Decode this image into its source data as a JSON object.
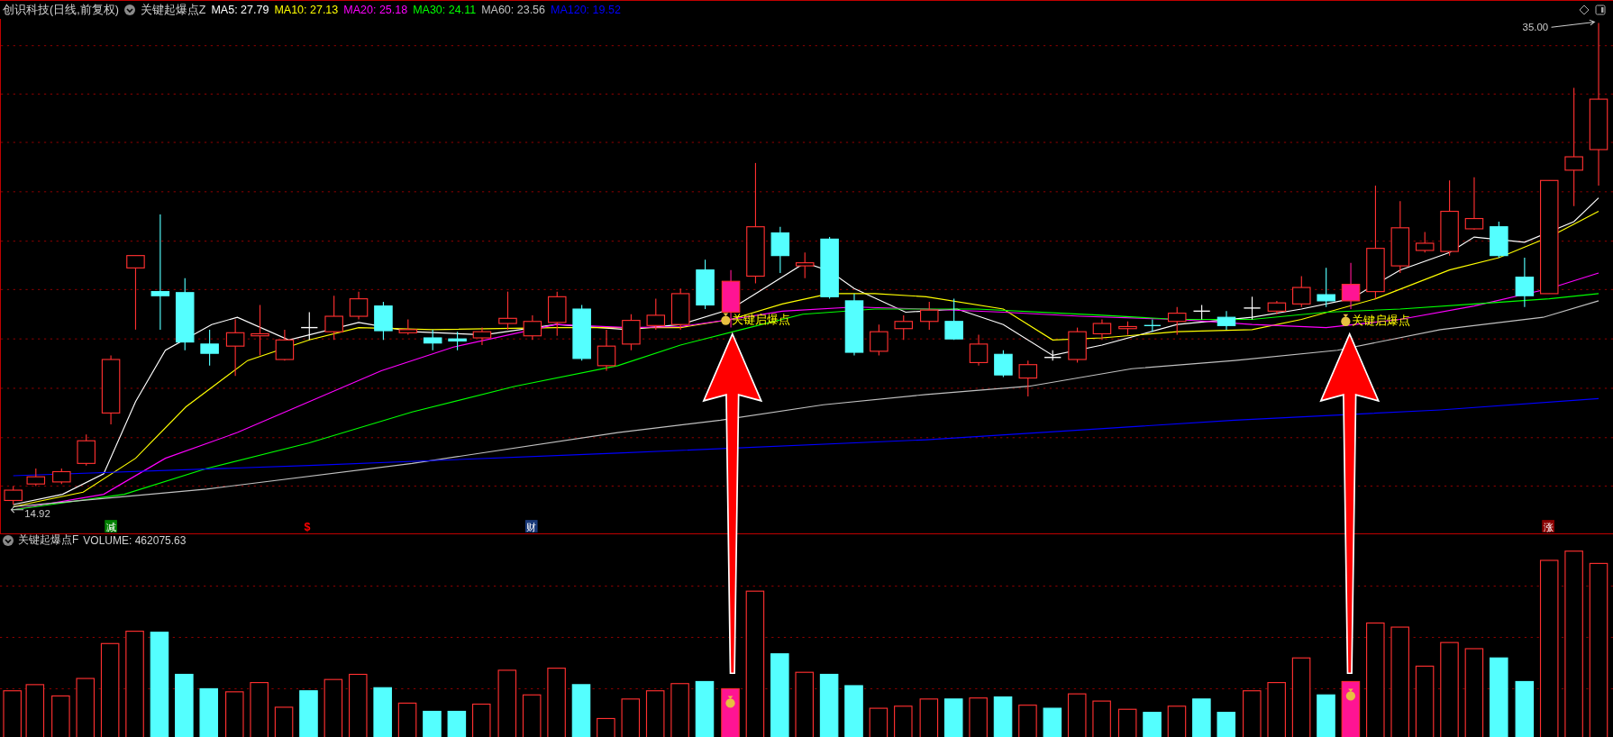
{
  "header": {
    "stock": "创识科技(日线,前复权)",
    "indicator": "关键起爆点Z",
    "moving_averages": [
      {
        "label": "MA5: 27.79",
        "color": "#ffffff"
      },
      {
        "label": "MA10: 27.13",
        "color": "#ffff00"
      },
      {
        "label": "MA20: 25.18",
        "color": "#ff00ff"
      },
      {
        "label": "MA30: 24.11",
        "color": "#00ff00"
      },
      {
        "label": "MA60: 23.56",
        "color": "#c0c0c0"
      },
      {
        "label": "MA120: 19.52",
        "color": "#0000ff"
      }
    ]
  },
  "price_chart": {
    "high_label": "35.00",
    "low_label": "14.92",
    "signals": [
      "关键启爆点",
      "关键启爆点"
    ],
    "event_markers": [
      {
        "text": "减",
        "kind": "badge",
        "color": "#008000"
      },
      {
        "text": "$",
        "kind": "glyph",
        "color": "#ff0000"
      },
      {
        "text": "财",
        "kind": "badge",
        "color": "#1a3a7a"
      },
      {
        "text": "涨",
        "kind": "badge",
        "color": "#8b0000"
      }
    ]
  },
  "volume_panel": {
    "indicator": "关键起爆点F",
    "reading": "VOLUME: 462075.63"
  }
}
